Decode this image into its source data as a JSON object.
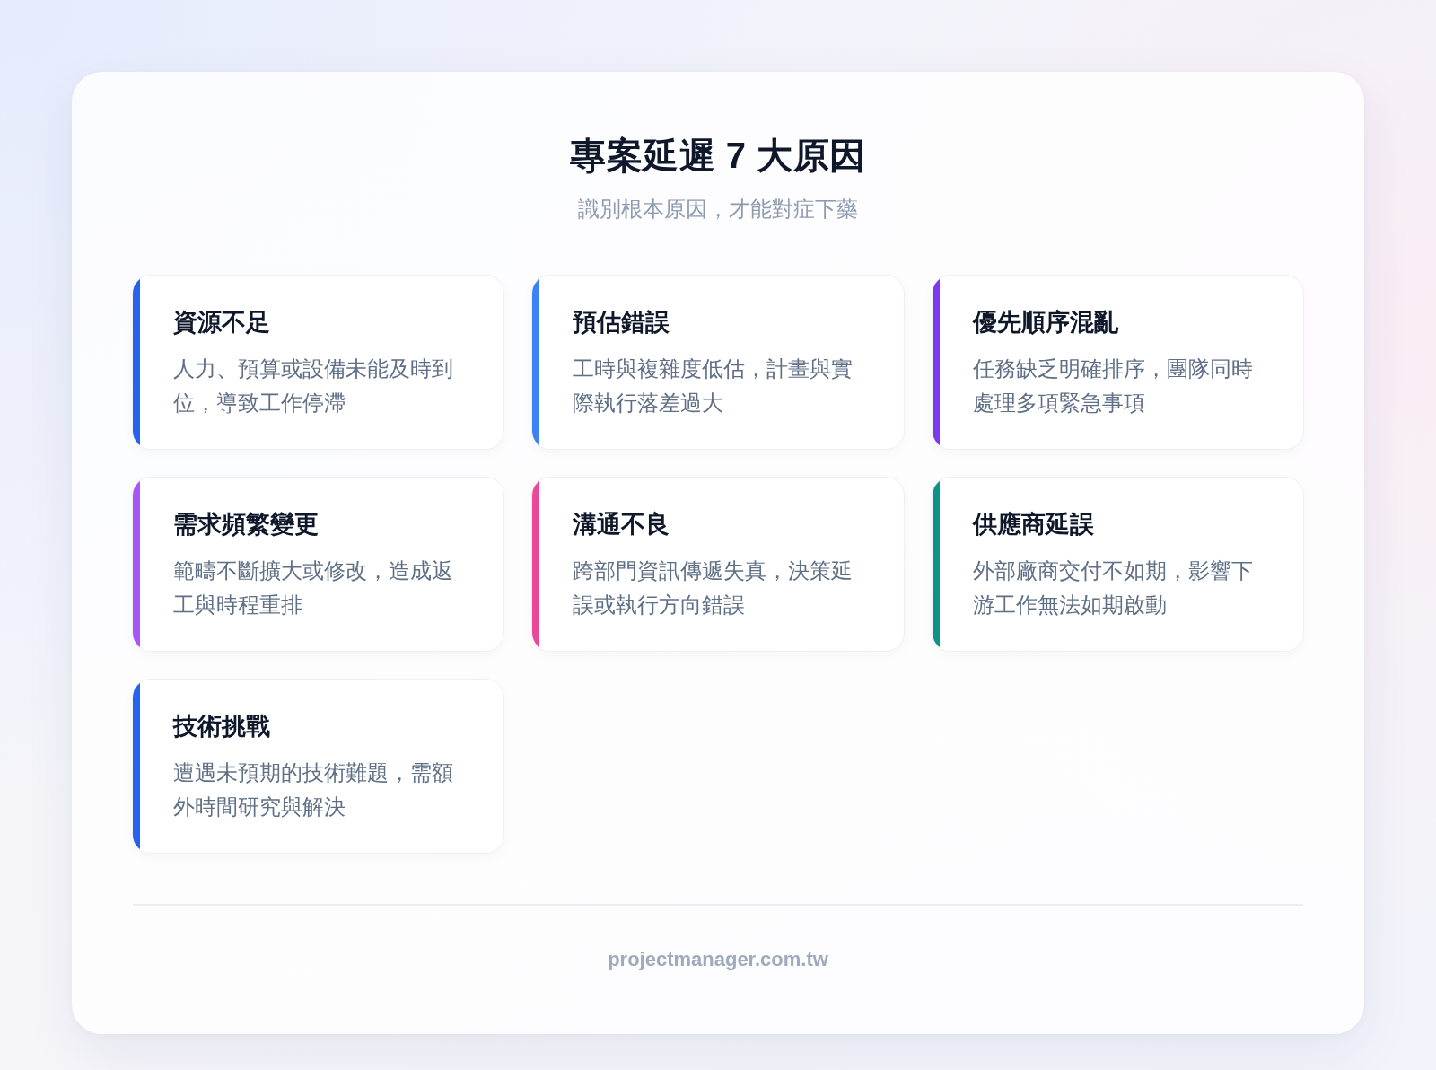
{
  "header": {
    "title": "專案延遲 7 大原因",
    "subtitle": "識別根本原因，才能對症下藥"
  },
  "causes": [
    {
      "title": "資源不足",
      "description": "人力、預算或設備未能及時到位，導致工作停滯",
      "color": "#2563eb"
    },
    {
      "title": "預估錯誤",
      "description": "工時與複雜度低估，計畫與實際執行落差過大",
      "color": "#3b82f6"
    },
    {
      "title": "優先順序混亂",
      "description": "任務缺乏明確排序，團隊同時處理多項緊急事項",
      "color": "#7c3aed"
    },
    {
      "title": "需求頻繁變更",
      "description": "範疇不斷擴大或修改，造成返工與時程重排",
      "color": "#a855f7"
    },
    {
      "title": "溝通不良",
      "description": "跨部門資訊傳遞失真，決策延誤或執行方向錯誤",
      "color": "#ec4899"
    },
    {
      "title": "供應商延誤",
      "description": "外部廠商交付不如期，影響下游工作無法如期啟動",
      "color": "#0d9488"
    },
    {
      "title": "技術挑戰",
      "description": "遭遇未預期的技術難題，需額外時間研究與解決",
      "color": "#2563eb"
    }
  ],
  "footer": {
    "text": "projectmanager.com.tw"
  }
}
